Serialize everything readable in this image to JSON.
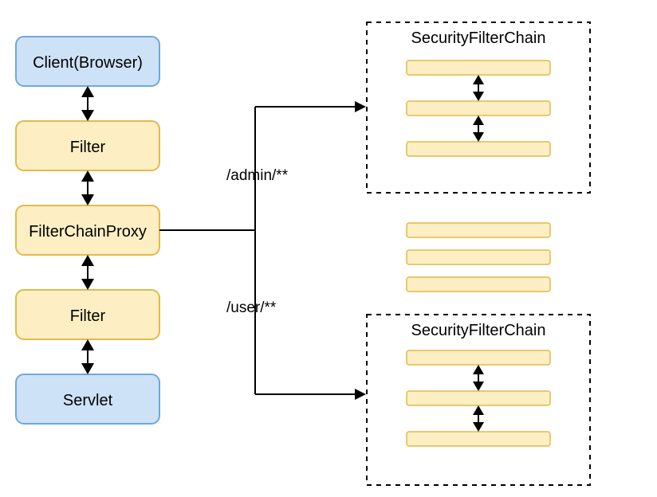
{
  "nodes": {
    "client": "Client(Browser)",
    "filter_top": "Filter",
    "proxy": "FilterChainProxy",
    "filter_bottom": "Filter",
    "servlet": "Servlet"
  },
  "routes": {
    "admin": "/admin/**",
    "user": "/user/**"
  },
  "chains": {
    "top_title": "SecurityFilterChain",
    "bottom_title": "SecurityFilterChain"
  },
  "colors": {
    "blue_fill": "#cde2f7",
    "blue_stroke": "#6fa8e0",
    "yellow_fill": "#fdefc3",
    "yellow_stroke": "#e2b94b"
  }
}
